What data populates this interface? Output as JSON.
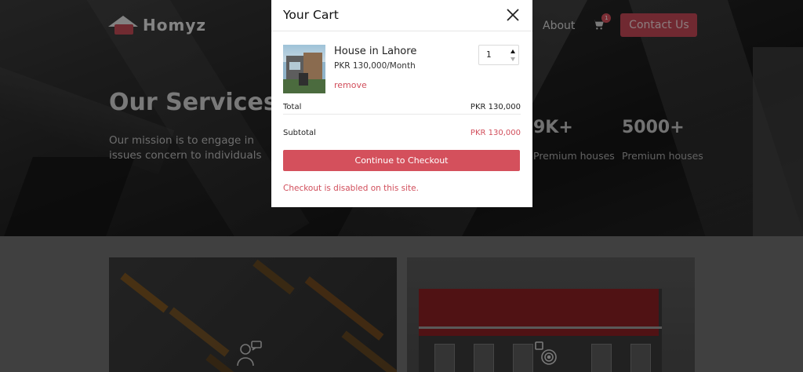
{
  "header": {
    "brand_name": "Homyz",
    "nav_about": "About",
    "cart_count": "1",
    "contact_label": "Contact Us"
  },
  "hero": {
    "title": "Our Services",
    "text": "Our mission is to engage in issues concern to individuals",
    "stats": [
      {
        "value": "9K+",
        "label": "Premium houses"
      },
      {
        "value": "5000+",
        "label": "Premium houses"
      }
    ]
  },
  "cart": {
    "title": "Your Cart",
    "item": {
      "name": "House in Lahore",
      "price": "PKR 130,000/Month",
      "remove_label": "remove",
      "quantity": "1"
    },
    "total_label": "Total",
    "total_value": "PKR 130,000",
    "subtotal_label": "Subtotal",
    "subtotal_value": "PKR 130,000",
    "checkout_label": "Continue to Checkout",
    "disabled_note": "Checkout is disabled on this site."
  },
  "colors": {
    "accent": "#d4505c",
    "contact_button": "#c24855",
    "overlay": "rgba(0,0,0,0.42)"
  },
  "icons": {
    "close": "close-icon",
    "cart": "cart-icon",
    "card_a": "user-chat-icon",
    "card_b": "target-icon"
  }
}
